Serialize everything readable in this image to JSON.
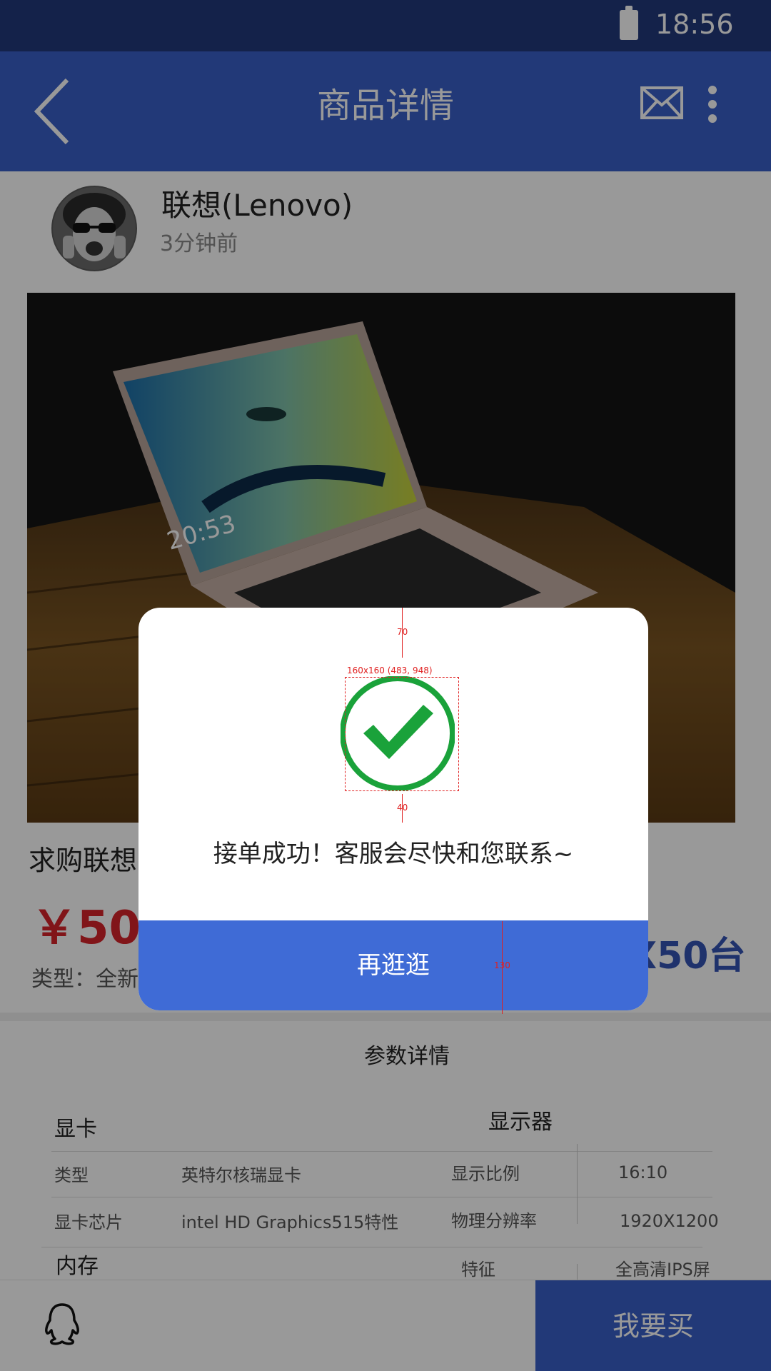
{
  "status_bar": {
    "time": "18:56",
    "battery_icon": "battery-icon"
  },
  "header": {
    "title": "商品详情",
    "back_icon": "back-arrow-icon",
    "mail_icon": "mail-icon",
    "more_icon": "more-vertical-icon"
  },
  "seller": {
    "name": "联想(Lenovo)",
    "posted": "3分钟前"
  },
  "product": {
    "title_visible": "求购联想",
    "price_visible": "￥500",
    "quantity_visible": "X50台",
    "type_visible": "类型：全新"
  },
  "specs": {
    "section_title": "参数详情",
    "gpu": {
      "heading": "显卡",
      "rows": [
        {
          "label": "类型",
          "value": "英特尔核瑞显卡"
        },
        {
          "label": "显卡芯片",
          "value": "intel HD Graphics515特性"
        }
      ]
    },
    "display": {
      "heading": "显示器",
      "rows": [
        {
          "label": "显示比例",
          "value": "16:10"
        },
        {
          "label": "物理分辨率",
          "value": "1920X1200"
        },
        {
          "label": "特征",
          "value": "全高清IPS屏"
        }
      ]
    },
    "memory": {
      "heading": "内存"
    }
  },
  "bottom_bar": {
    "chat_icon": "qq-icon",
    "buy_label": "我要买"
  },
  "dialog": {
    "message": "接单成功！客服会尽快和您联系~",
    "button_label": "再逛逛",
    "success_icon": "check-circle-icon",
    "accent_color": "#1aa23a",
    "button_color": "#3f6bd6"
  },
  "annotations": {
    "top_gap": "70",
    "icon_box": "160x160 (483, 948)",
    "bottom_gap": "40",
    "button_height": "130"
  }
}
